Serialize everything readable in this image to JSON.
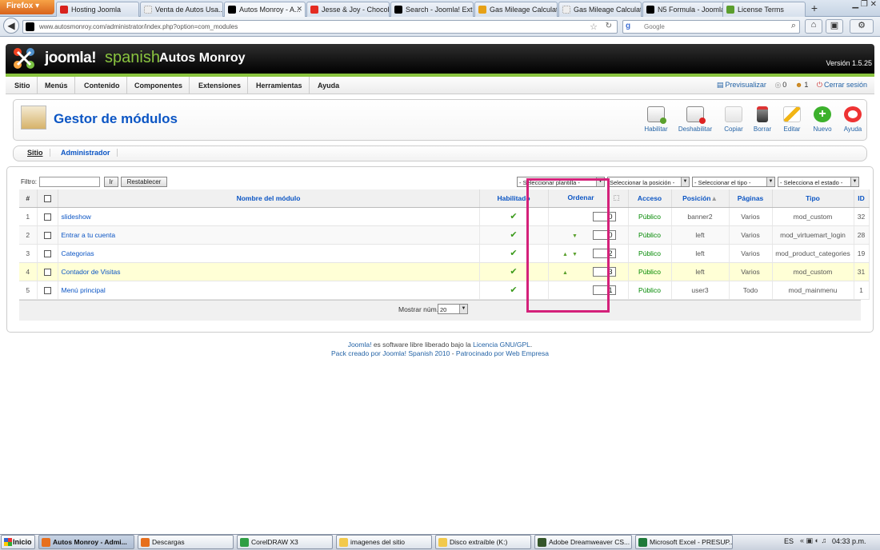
{
  "browser": {
    "menu_button": "Firefox",
    "tabs": [
      {
        "label": "Hosting Joomla",
        "active": false
      },
      {
        "label": "Venta de Autos Usa...",
        "active": false
      },
      {
        "label": "Autos Monroy - A...",
        "active": true
      },
      {
        "label": "Jesse & Joy - Chocol...",
        "active": false
      },
      {
        "label": "Search - Joomla! Ext...",
        "active": false
      },
      {
        "label": "Gas Mileage Calculat...",
        "active": false
      },
      {
        "label": "Gas Mileage Calculator",
        "active": false
      },
      {
        "label": "N5 Formula - Joomla...",
        "active": false
      },
      {
        "label": "License Terms",
        "active": false
      }
    ],
    "url": "www.autosmonroy.com/administrator/index.php?option=com_modules",
    "search_placeholder": "Google"
  },
  "header": {
    "logo_text": "joomla!",
    "logo_variant": "spanish",
    "site_name": "Autos Monroy",
    "version": "Versión 1.5.25"
  },
  "menu": {
    "items": [
      "Sitio",
      "Menús",
      "Contenido",
      "Componentes",
      "Extensiones",
      "Herramientas",
      "Ayuda"
    ],
    "preview": "Previsualizar",
    "messages_count": "0",
    "users_count": "1",
    "logout": "Cerrar sesión"
  },
  "toolbar": {
    "title": "Gestor de módulos",
    "buttons": [
      {
        "label": "Habilitar",
        "icon": "enable-icon"
      },
      {
        "label": "Deshabilitar",
        "icon": "disable-icon"
      },
      {
        "label": "Copiar",
        "icon": "copy-icon"
      },
      {
        "label": "Borrar",
        "icon": "trash-icon"
      },
      {
        "label": "Editar",
        "icon": "edit-icon"
      },
      {
        "label": "Nuevo",
        "icon": "new-icon"
      },
      {
        "label": "Ayuda",
        "icon": "help-icon"
      }
    ]
  },
  "submenu": {
    "items": [
      {
        "label": "Sitio",
        "active": true
      },
      {
        "label": "Administrador",
        "active": false
      }
    ]
  },
  "filter": {
    "label": "Filtro:",
    "value": "",
    "go_button": "Ir",
    "reset_button": "Restablecer",
    "selects": [
      "- Seleccionar plantilla -",
      "Seleccionar la posición -",
      "- Seleccionar el tipo -",
      "- Selecciona el estado -"
    ]
  },
  "table": {
    "headers": {
      "num": "#",
      "name": "Nombre del módulo",
      "enabled": "Habilitado",
      "order": "Ordenar",
      "access": "Acceso",
      "position": "Posición",
      "pages": "Páginas",
      "type": "Tipo",
      "id": "ID"
    },
    "rows": [
      {
        "num": "1",
        "name": "slideshow",
        "order": "0",
        "up": false,
        "down": false,
        "access": "Público",
        "position": "banner2",
        "pages": "Varios",
        "type": "mod_custom",
        "id": "32"
      },
      {
        "num": "2",
        "name": "Entrar a tu cuenta",
        "order": "0",
        "up": false,
        "down": true,
        "access": "Público",
        "position": "left",
        "pages": "Varios",
        "type": "mod_virtuemart_login",
        "id": "28"
      },
      {
        "num": "3",
        "name": "Categorias",
        "order": "2",
        "up": true,
        "down": true,
        "access": "Público",
        "position": "left",
        "pages": "Varios",
        "type": "mod_product_categories",
        "id": "19"
      },
      {
        "num": "4",
        "name": "Contador de Visitas",
        "order": "3",
        "up": true,
        "down": false,
        "access": "Público",
        "position": "left",
        "pages": "Varios",
        "type": "mod_custom",
        "id": "31"
      },
      {
        "num": "5",
        "name": "Menú principal",
        "order": "1",
        "up": false,
        "down": false,
        "access": "Público",
        "position": "user3",
        "pages": "Todo",
        "type": "mod_mainmenu",
        "id": "1"
      }
    ],
    "show_label": "Mostrar núm.",
    "show_value": "20"
  },
  "footer": {
    "line1_a": "Joomla!",
    "line1_b": " es software libre liberado bajo la ",
    "line1_c": "Licencia GNU/GPL",
    "line1_d": ".",
    "line2_a": "Pack creado por Joomla! Spanish 2010",
    "line2_b": " - ",
    "line2_c": "Patrocinado por Web Empresa"
  },
  "taskbar": {
    "start": "Inicio",
    "tasks": [
      {
        "label": "Autos Monroy - Admi...",
        "active": true
      },
      {
        "label": "Descargas",
        "active": false
      },
      {
        "label": "CorelDRAW X3",
        "active": false
      },
      {
        "label": "imagenes del sitio",
        "active": false
      },
      {
        "label": "Disco extraíble (K:)",
        "active": false
      },
      {
        "label": "Adobe Dreamweaver CS...",
        "active": false
      },
      {
        "label": "Microsoft Excel - PRESUP...",
        "active": false
      }
    ],
    "lang": "ES",
    "clock": "04:33 p.m."
  },
  "colors": {
    "joomla_blue": "#0b55c4",
    "joomla_green": "#8ac43f",
    "highlight_pink": "#d4217a",
    "access_green": "#008800"
  }
}
